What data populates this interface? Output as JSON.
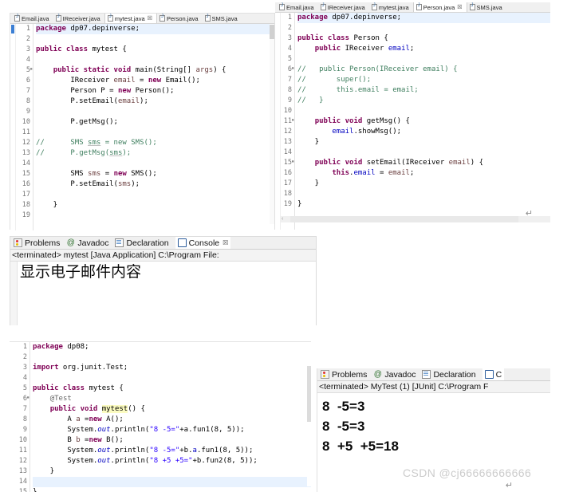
{
  "editor_top_left": {
    "tabs": [
      {
        "label": "Email.java",
        "active": false,
        "dirty": false
      },
      {
        "label": "IReceiver.java",
        "active": false,
        "dirty": false
      },
      {
        "label": "mytest.java",
        "active": true,
        "dirty": false
      },
      {
        "label": "Person.java",
        "active": false,
        "dirty": false
      },
      {
        "label": "SMS.java",
        "active": false,
        "dirty": false
      }
    ],
    "lines": [
      {
        "n": "1",
        "fold": false,
        "highlight": true,
        "tokens": [
          {
            "t": "package",
            "c": "k"
          },
          {
            "t": " dp07.depinverse;",
            "c": ""
          }
        ]
      },
      {
        "n": "2",
        "fold": false,
        "highlight": false,
        "tokens": []
      },
      {
        "n": "3",
        "fold": false,
        "highlight": false,
        "tokens": [
          {
            "t": "public class",
            "c": "k"
          },
          {
            "t": " mytest {",
            "c": ""
          }
        ]
      },
      {
        "n": "4",
        "fold": false,
        "highlight": false,
        "tokens": []
      },
      {
        "n": "5",
        "fold": true,
        "highlight": false,
        "tokens": [
          {
            "t": "    ",
            "c": ""
          },
          {
            "t": "public static void",
            "c": "k"
          },
          {
            "t": " main(String[] ",
            "c": ""
          },
          {
            "t": "args",
            "c": "pm"
          },
          {
            "t": ") {",
            "c": ""
          }
        ]
      },
      {
        "n": "6",
        "fold": false,
        "highlight": false,
        "tokens": [
          {
            "t": "        IReceiver ",
            "c": ""
          },
          {
            "t": "email",
            "c": "pm"
          },
          {
            "t": " = ",
            "c": ""
          },
          {
            "t": "new",
            "c": "k"
          },
          {
            "t": " Email();",
            "c": ""
          }
        ]
      },
      {
        "n": "7",
        "fold": false,
        "highlight": false,
        "tokens": [
          {
            "t": "        Person P = ",
            "c": ""
          },
          {
            "t": "new",
            "c": "k"
          },
          {
            "t": " Person();",
            "c": ""
          }
        ]
      },
      {
        "n": "8",
        "fold": false,
        "highlight": false,
        "tokens": [
          {
            "t": "        P.setEmail(",
            "c": ""
          },
          {
            "t": "email",
            "c": "pm"
          },
          {
            "t": ");",
            "c": ""
          }
        ]
      },
      {
        "n": "9",
        "fold": false,
        "highlight": false,
        "tokens": []
      },
      {
        "n": "10",
        "fold": false,
        "highlight": false,
        "tokens": [
          {
            "t": "        P.getMsg();",
            "c": ""
          }
        ]
      },
      {
        "n": "11",
        "fold": false,
        "highlight": false,
        "tokens": []
      },
      {
        "n": "12",
        "fold": false,
        "highlight": false,
        "tokens": [
          {
            "t": "//",
            "c": "cm"
          },
          {
            "t": "      SMS ",
            "c": "cm"
          },
          {
            "t": "sms",
            "c": "cm ul"
          },
          {
            "t": " = new SMS();",
            "c": "cm"
          }
        ]
      },
      {
        "n": "13",
        "fold": false,
        "highlight": false,
        "tokens": [
          {
            "t": "//",
            "c": "cm"
          },
          {
            "t": "      P.getMsg(",
            "c": "cm"
          },
          {
            "t": "sms",
            "c": "cm ul"
          },
          {
            "t": ");",
            "c": "cm"
          }
        ]
      },
      {
        "n": "14",
        "fold": false,
        "highlight": false,
        "tokens": []
      },
      {
        "n": "15",
        "fold": false,
        "highlight": false,
        "tokens": [
          {
            "t": "        SMS ",
            "c": ""
          },
          {
            "t": "sms",
            "c": "pm"
          },
          {
            "t": " = ",
            "c": ""
          },
          {
            "t": "new",
            "c": "k"
          },
          {
            "t": " SMS();",
            "c": ""
          }
        ]
      },
      {
        "n": "16",
        "fold": false,
        "highlight": false,
        "tokens": [
          {
            "t": "        P.setEmail(",
            "c": ""
          },
          {
            "t": "sms",
            "c": "pm"
          },
          {
            "t": ");",
            "c": ""
          }
        ]
      },
      {
        "n": "17",
        "fold": false,
        "highlight": false,
        "tokens": []
      },
      {
        "n": "18",
        "fold": false,
        "highlight": false,
        "tokens": [
          {
            "t": "    }",
            "c": ""
          }
        ]
      },
      {
        "n": "19",
        "fold": false,
        "highlight": false,
        "tokens": []
      }
    ]
  },
  "editor_top_right": {
    "tabs": [
      {
        "label": "Email.java",
        "active": false,
        "dirty": false
      },
      {
        "label": "IReceiver.java",
        "active": false,
        "dirty": false
      },
      {
        "label": "mytest.java",
        "active": false,
        "dirty": false
      },
      {
        "label": "Person.java",
        "active": true,
        "dirty": false
      },
      {
        "label": "SMS.java",
        "active": false,
        "dirty": false
      }
    ],
    "lines": [
      {
        "n": "1",
        "fold": false,
        "highlight": true,
        "tokens": [
          {
            "t": "package",
            "c": "k"
          },
          {
            "t": " dp07.depinverse;",
            "c": ""
          }
        ]
      },
      {
        "n": "2",
        "fold": false,
        "highlight": false,
        "tokens": []
      },
      {
        "n": "3",
        "fold": false,
        "highlight": false,
        "tokens": [
          {
            "t": "public class",
            "c": "k"
          },
          {
            "t": " Person {",
            "c": ""
          }
        ]
      },
      {
        "n": "4",
        "fold": false,
        "highlight": false,
        "tokens": [
          {
            "t": "    ",
            "c": ""
          },
          {
            "t": "public",
            "c": "k"
          },
          {
            "t": " IReceiver ",
            "c": ""
          },
          {
            "t": "email",
            "c": "fl"
          },
          {
            "t": ";",
            "c": ""
          }
        ]
      },
      {
        "n": "5",
        "fold": false,
        "highlight": false,
        "tokens": []
      },
      {
        "n": "6",
        "fold": true,
        "highlight": false,
        "tokens": [
          {
            "t": "//",
            "c": "cm"
          },
          {
            "t": "   public Person(IReceiver email) {",
            "c": "cm"
          }
        ]
      },
      {
        "n": "7",
        "fold": false,
        "highlight": false,
        "tokens": [
          {
            "t": "//",
            "c": "cm"
          },
          {
            "t": "       super();",
            "c": "cm"
          }
        ]
      },
      {
        "n": "8",
        "fold": false,
        "highlight": false,
        "tokens": [
          {
            "t": "//",
            "c": "cm"
          },
          {
            "t": "       this.email = email;",
            "c": "cm"
          }
        ]
      },
      {
        "n": "9",
        "fold": false,
        "highlight": false,
        "tokens": [
          {
            "t": "//",
            "c": "cm"
          },
          {
            "t": "   }",
            "c": "cm"
          }
        ]
      },
      {
        "n": "10",
        "fold": false,
        "highlight": false,
        "tokens": []
      },
      {
        "n": "11",
        "fold": true,
        "highlight": false,
        "tokens": [
          {
            "t": "    ",
            "c": ""
          },
          {
            "t": "public void",
            "c": "k"
          },
          {
            "t": " getMsg() {",
            "c": ""
          }
        ]
      },
      {
        "n": "12",
        "fold": false,
        "highlight": false,
        "tokens": [
          {
            "t": "        ",
            "c": ""
          },
          {
            "t": "email",
            "c": "fl"
          },
          {
            "t": ".showMsg();",
            "c": ""
          }
        ]
      },
      {
        "n": "13",
        "fold": false,
        "highlight": false,
        "tokens": [
          {
            "t": "    }",
            "c": ""
          }
        ]
      },
      {
        "n": "14",
        "fold": false,
        "highlight": false,
        "tokens": []
      },
      {
        "n": "15",
        "fold": true,
        "highlight": false,
        "tokens": [
          {
            "t": "    ",
            "c": ""
          },
          {
            "t": "public void",
            "c": "k"
          },
          {
            "t": " setEmail(IReceiver ",
            "c": ""
          },
          {
            "t": "email",
            "c": "pm"
          },
          {
            "t": ") {",
            "c": ""
          }
        ]
      },
      {
        "n": "16",
        "fold": false,
        "highlight": false,
        "tokens": [
          {
            "t": "        ",
            "c": ""
          },
          {
            "t": "this",
            "c": "k"
          },
          {
            "t": ".",
            "c": ""
          },
          {
            "t": "email",
            "c": "fl"
          },
          {
            "t": " = ",
            "c": ""
          },
          {
            "t": "email",
            "c": "pm"
          },
          {
            "t": ";",
            "c": ""
          }
        ]
      },
      {
        "n": "17",
        "fold": false,
        "highlight": false,
        "tokens": [
          {
            "t": "    }",
            "c": ""
          }
        ]
      },
      {
        "n": "18",
        "fold": false,
        "highlight": false,
        "tokens": []
      },
      {
        "n": "19",
        "fold": false,
        "highlight": false,
        "tokens": [
          {
            "t": "}",
            "c": ""
          }
        ]
      }
    ]
  },
  "console_top": {
    "tabs": [
      {
        "label": "Problems",
        "icon": "problems-icon",
        "active": false
      },
      {
        "label": "Javadoc",
        "icon": "javadoc-icon",
        "active": false
      },
      {
        "label": "Declaration",
        "icon": "declaration-icon",
        "active": false
      },
      {
        "label": "Console",
        "icon": "console-icon",
        "active": true,
        "close": "☒"
      }
    ],
    "header": "<terminated> mytest [Java Application] C:\\Program File:",
    "output": [
      "显示电子邮件内容"
    ]
  },
  "editor_bottom_left": {
    "lines": [
      {
        "n": "1",
        "fold": false,
        "highlight": false,
        "tokens": [
          {
            "t": "package",
            "c": "k"
          },
          {
            "t": " dp08;",
            "c": ""
          }
        ]
      },
      {
        "n": "2",
        "fold": false,
        "highlight": false,
        "tokens": []
      },
      {
        "n": "3",
        "fold": false,
        "highlight": false,
        "tokens": [
          {
            "t": "import",
            "c": "k"
          },
          {
            "t": " org.junit.Test;",
            "c": ""
          }
        ]
      },
      {
        "n": "4",
        "fold": false,
        "highlight": false,
        "tokens": []
      },
      {
        "n": "5",
        "fold": false,
        "highlight": false,
        "tokens": [
          {
            "t": "public class",
            "c": "k"
          },
          {
            "t": " mytest {",
            "c": ""
          }
        ]
      },
      {
        "n": "6",
        "fold": true,
        "highlight": false,
        "tokens": [
          {
            "t": "    ",
            "c": ""
          },
          {
            "t": "@Test",
            "c": "an"
          }
        ]
      },
      {
        "n": "7",
        "fold": false,
        "highlight": false,
        "tokens": [
          {
            "t": "    ",
            "c": ""
          },
          {
            "t": "public void",
            "c": "k"
          },
          {
            "t": " ",
            "c": ""
          },
          {
            "t": "mytest",
            "c": "mark"
          },
          {
            "t": "() {",
            "c": ""
          }
        ]
      },
      {
        "n": "8",
        "fold": false,
        "highlight": false,
        "tokens": [
          {
            "t": "        A ",
            "c": ""
          },
          {
            "t": "a",
            "c": "pm"
          },
          {
            "t": " =",
            "c": ""
          },
          {
            "t": "new",
            "c": "k"
          },
          {
            "t": " A();",
            "c": ""
          }
        ]
      },
      {
        "n": "9",
        "fold": false,
        "highlight": false,
        "tokens": [
          {
            "t": "        System.",
            "c": ""
          },
          {
            "t": "out",
            "c": "sf"
          },
          {
            "t": ".println(",
            "c": ""
          },
          {
            "t": "\"8 -5=\"",
            "c": "st"
          },
          {
            "t": "+a.fun1(8, 5));",
            "c": ""
          }
        ]
      },
      {
        "n": "10",
        "fold": false,
        "highlight": false,
        "tokens": [
          {
            "t": "        B ",
            "c": ""
          },
          {
            "t": "b",
            "c": "pm"
          },
          {
            "t": " =",
            "c": ""
          },
          {
            "t": "new",
            "c": "k"
          },
          {
            "t": " B();",
            "c": ""
          }
        ]
      },
      {
        "n": "11",
        "fold": false,
        "highlight": false,
        "tokens": [
          {
            "t": "        System.",
            "c": ""
          },
          {
            "t": "out",
            "c": "sf"
          },
          {
            "t": ".println(",
            "c": ""
          },
          {
            "t": "\"8 -5=\"",
            "c": "st"
          },
          {
            "t": "+b.",
            "c": ""
          },
          {
            "t": "a",
            "c": "fl"
          },
          {
            "t": ".fun1(8, 5));",
            "c": ""
          }
        ]
      },
      {
        "n": "12",
        "fold": false,
        "highlight": false,
        "tokens": [
          {
            "t": "        System.",
            "c": ""
          },
          {
            "t": "out",
            "c": "sf"
          },
          {
            "t": ".println(",
            "c": ""
          },
          {
            "t": "\"8 +5 +5=\"",
            "c": "st"
          },
          {
            "t": "+b.fun2(8, 5));",
            "c": ""
          }
        ]
      },
      {
        "n": "13",
        "fold": false,
        "highlight": false,
        "tokens": [
          {
            "t": "    }",
            "c": ""
          }
        ]
      },
      {
        "n": "14",
        "fold": false,
        "highlight": true,
        "tokens": [
          {
            "t": "",
            "c": ""
          }
        ]
      },
      {
        "n": "15",
        "fold": false,
        "highlight": false,
        "tokens": [
          {
            "t": "}",
            "c": ""
          }
        ]
      }
    ]
  },
  "console_bottom": {
    "tabs": [
      {
        "label": "Problems",
        "icon": "problems-icon",
        "active": false
      },
      {
        "label": "Javadoc",
        "icon": "javadoc-icon",
        "active": false
      },
      {
        "label": "Declaration",
        "icon": "declaration-icon",
        "active": false
      },
      {
        "label": "C",
        "icon": "console-icon",
        "active": true
      }
    ],
    "header": "<terminated> MyTest (1) [JUnit] C:\\Program F",
    "output": [
      "8  -5=3",
      "8  -5=3",
      "8  +5  +5=18"
    ]
  },
  "watermark": "CSDN @cj66666666666",
  "colors": {
    "keyword": "#7f0055",
    "comment": "#3f7f5f",
    "string": "#2a00ff",
    "field": "#0000c0",
    "param": "#6a3e3e",
    "line_highlight": "#e8f2fe",
    "tab_bar": "#f0f0f0"
  }
}
